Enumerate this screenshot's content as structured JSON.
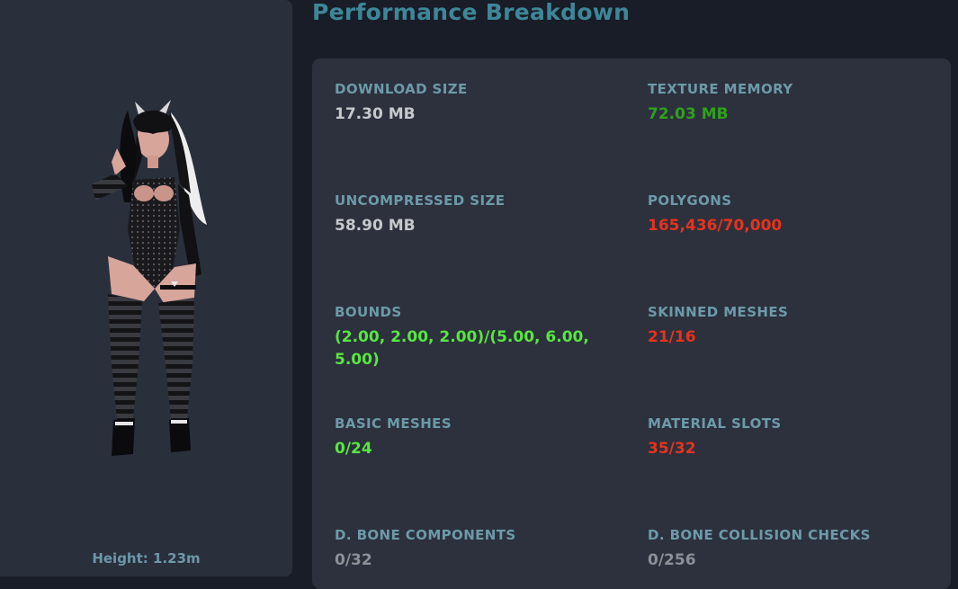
{
  "avatar_panel": {
    "height_text": "Height: 1.23m"
  },
  "title": "Performance Breakdown",
  "colors": {
    "neutral": "#c6c8cc",
    "good": "#58e63f",
    "ok": "#2fa11c",
    "bad": "#e8321c",
    "muted": "#8d9098",
    "label": "#6d9aa8",
    "title": "#3e8699"
  },
  "stats": [
    {
      "label": "DOWNLOAD SIZE",
      "value": "17.30 MB",
      "status": "neutral"
    },
    {
      "label": "TEXTURE MEMORY",
      "value": "72.03 MB",
      "status": "ok"
    },
    {
      "label": "UNCOMPRESSED SIZE",
      "value": "58.90 MB",
      "status": "neutral"
    },
    {
      "label": "POLYGONS",
      "value": "165,436/70,000",
      "status": "bad"
    },
    {
      "label": "BOUNDS",
      "value": "(2.00, 2.00, 2.00)/(5.00, 6.00, 5.00)",
      "status": "good"
    },
    {
      "label": "SKINNED MESHES",
      "value": "21/16",
      "status": "bad"
    },
    {
      "label": "BASIC MESHES",
      "value": "0/24",
      "status": "good"
    },
    {
      "label": "MATERIAL SLOTS",
      "value": "35/32",
      "status": "bad"
    },
    {
      "label": "D. BONE COMPONENTS",
      "value": "0/32",
      "status": "muted"
    },
    {
      "label": "D. BONE COLLISION CHECKS",
      "value": "0/256",
      "status": "muted"
    }
  ]
}
